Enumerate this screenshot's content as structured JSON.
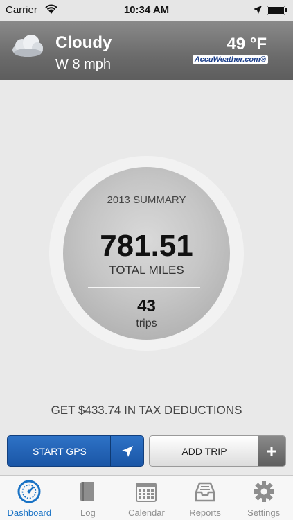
{
  "status_bar": {
    "carrier": "Carrier",
    "time": "10:34 AM"
  },
  "weather": {
    "condition": "Cloudy",
    "wind": "W 8 mph",
    "temperature": "49 °F",
    "brand": "AccuWeather.com®",
    "icon": "cloud-icon"
  },
  "summary": {
    "title": "2013 SUMMARY",
    "miles_value": "781.51",
    "miles_label": "TOTAL MILES",
    "trips_value": "43",
    "trips_label": "trips"
  },
  "tax": {
    "text": "GET $433.74 IN TAX DEDUCTIONS"
  },
  "actions": {
    "start_gps": "START GPS",
    "add_trip": "ADD TRIP"
  },
  "tabs": [
    {
      "label": "Dashboard",
      "icon": "dashboard-gauge-icon",
      "active": true
    },
    {
      "label": "Log",
      "icon": "book-icon",
      "active": false
    },
    {
      "label": "Calendar",
      "icon": "calendar-icon",
      "active": false
    },
    {
      "label": "Reports",
      "icon": "inbox-tray-icon",
      "active": false
    },
    {
      "label": "Settings",
      "icon": "gear-icon",
      "active": false
    }
  ],
  "colors": {
    "accent": "#1a73c5",
    "gps_button": "#1a56a6",
    "weather_bar": "#6b6b6b"
  }
}
